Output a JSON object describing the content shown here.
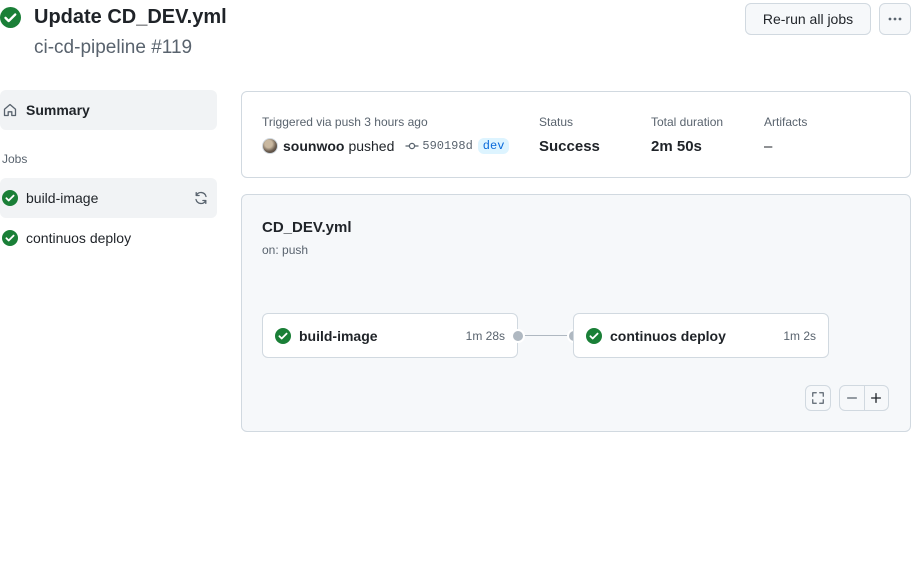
{
  "header": {
    "title": "Update CD_DEV.yml",
    "subtitle": "ci-cd-pipeline #119",
    "rerun_label": "Re-run all jobs",
    "more_icon": "kebab-horizontal-icon"
  },
  "sidebar": {
    "summary_label": "Summary",
    "jobs_heading": "Jobs",
    "jobs": [
      {
        "label": "build-image",
        "status": "success",
        "active": true
      },
      {
        "label": "continuos deploy",
        "status": "success",
        "active": false
      }
    ]
  },
  "summary": {
    "trigger_label": "Triggered via push 3 hours ago",
    "actor": "sounwoo",
    "action": "pushed",
    "commit_sha": "590198d",
    "branch": "dev",
    "status_label": "Status",
    "status_value": "Success",
    "duration_label": "Total duration",
    "duration_value": "2m 50s",
    "artifacts_label": "Artifacts",
    "artifacts_value": "–"
  },
  "workflow": {
    "file": "CD_DEV.yml",
    "trigger": "on: push",
    "nodes": [
      {
        "label": "build-image",
        "duration": "1m 28s"
      },
      {
        "label": "continuos deploy",
        "duration": "1m 2s"
      }
    ]
  },
  "colors": {
    "success": "#1a7f37",
    "border": "#d1d9e0",
    "muted": "#59636e",
    "branch_bg": "#ddf4ff",
    "branch_fg": "#0969da"
  }
}
